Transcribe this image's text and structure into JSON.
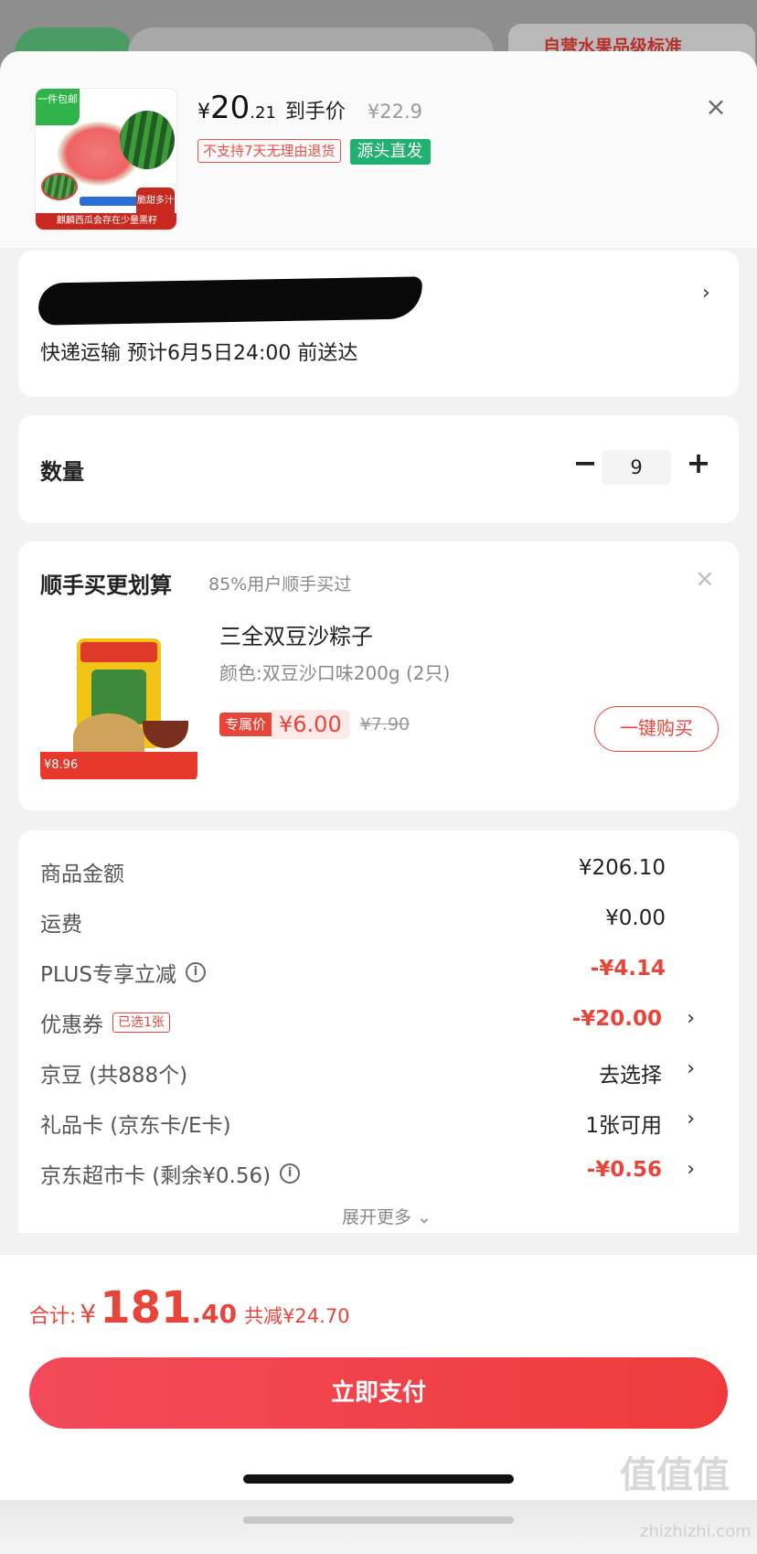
{
  "background": {
    "tag_text": "自营水果品级标准"
  },
  "product": {
    "badge": "一件包邮",
    "thumb_tag": "脆甜多汁",
    "thumb_bottom": "麒麟西瓜会存在少量黑籽",
    "price_symbol": "¥",
    "price_int": "20",
    "price_dec": ".21",
    "price_label": "到手价",
    "original_price": "¥22.9",
    "tag_no_return": "不支持7天无理由退货",
    "tag_source": "源头直发",
    "close_icon": "close-icon"
  },
  "address": {
    "delivery": "快递运输 预计6月5日24:00 前送达"
  },
  "quantity": {
    "label": "数量",
    "value": "9",
    "minus": "−",
    "plus": "+"
  },
  "upsell": {
    "title": "顺手买更划算",
    "subtitle": "85%用户顺手买过",
    "name": "三全双豆沙粽子",
    "variant": "颜色:双豆沙口味200g (2只)",
    "exclusive_tag": "专属价",
    "price": "¥6.00",
    "original_price": "¥7.90",
    "image_price": "¥8.96",
    "buy_label": "一键购买"
  },
  "summary": {
    "rows": [
      {
        "label": "商品金额",
        "value": "¥206.10"
      },
      {
        "label": "运费",
        "value": "¥0.00"
      },
      {
        "label": "PLUS专享立减",
        "value": "-¥4.14"
      },
      {
        "label": "优惠券",
        "tag": "已选1张",
        "value": "-¥20.00"
      },
      {
        "label": "京豆 (共888个)",
        "value": "去选择"
      },
      {
        "label": "礼品卡 (京东卡/E卡)",
        "value": "1张可用"
      },
      {
        "label": "京东超市卡 (剩余¥0.56)",
        "value": "-¥0.56"
      }
    ],
    "expand": "展开更多 ⌄"
  },
  "footer": {
    "total_label": "合计:",
    "total_symbol": "¥",
    "total_int": "181",
    "total_dec": ".40",
    "saved": "共减¥24.70",
    "pay_label": "立即支付"
  },
  "watermark": {
    "logo": "值值值",
    "site": "zhizhizhi.com"
  },
  "colors": {
    "accent_red": "#e8453a",
    "green": "#1fb072"
  }
}
